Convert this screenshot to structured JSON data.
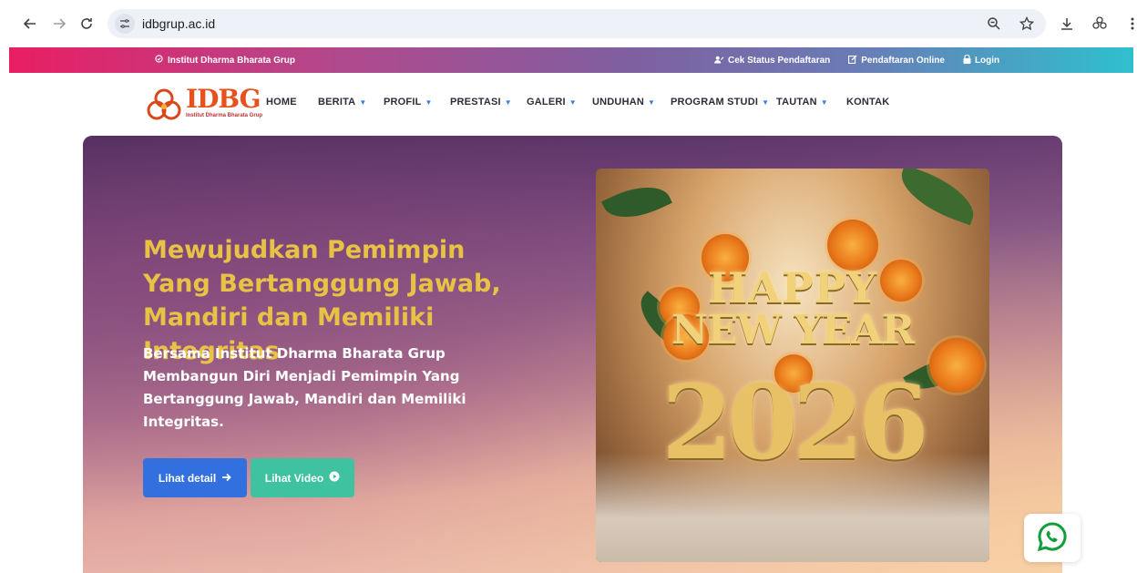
{
  "browser": {
    "url": "idbgrup.ac.id"
  },
  "top_strip": {
    "institute": "Institut Dharma Bharata Grup",
    "links": [
      {
        "label": "Cek Status Pendaftaran",
        "icon": "user-check-icon"
      },
      {
        "label": "Pendaftaran Online",
        "icon": "edit-icon"
      },
      {
        "label": "Login",
        "icon": "lock-icon"
      }
    ]
  },
  "logo": {
    "title": "IDBG",
    "subtitle": "Institut Dharma Bharata Grup"
  },
  "nav": {
    "items": [
      {
        "label": "HOME",
        "dropdown": false
      },
      {
        "label": "BERITA",
        "dropdown": true
      },
      {
        "label": "PROFIL",
        "dropdown": true
      },
      {
        "label": "PRESTASI",
        "dropdown": true
      },
      {
        "label": "GALERI",
        "dropdown": true
      },
      {
        "label": "UNDUHAN",
        "dropdown": true
      },
      {
        "label": "PROGRAM STUDI",
        "dropdown": true
      },
      {
        "label": "TAUTAN",
        "dropdown": true
      },
      {
        "label": "KONTAK",
        "dropdown": false
      }
    ]
  },
  "hero": {
    "title": "Mewujudkan Pemimpin Yang Bertanggung Jawab, Mandiri dan Memiliki Integritas",
    "description": "Bersama Institut Dharma Bharata Grup Membangun Diri Menjadi Pemimpin Yang Bertanggung Jawab, Mandiri dan Memiliki Integritas.",
    "detail_button": "Lihat detail",
    "video_button": "Lihat Video"
  },
  "promo": {
    "line1": "HAPPY",
    "line2": "NEW YEAR",
    "year": "2026"
  },
  "colors": {
    "accent_blue": "#3270e0",
    "accent_green": "#3fc2a0",
    "hero_title": "#e8c245",
    "logo_orange": "#e8501c"
  }
}
